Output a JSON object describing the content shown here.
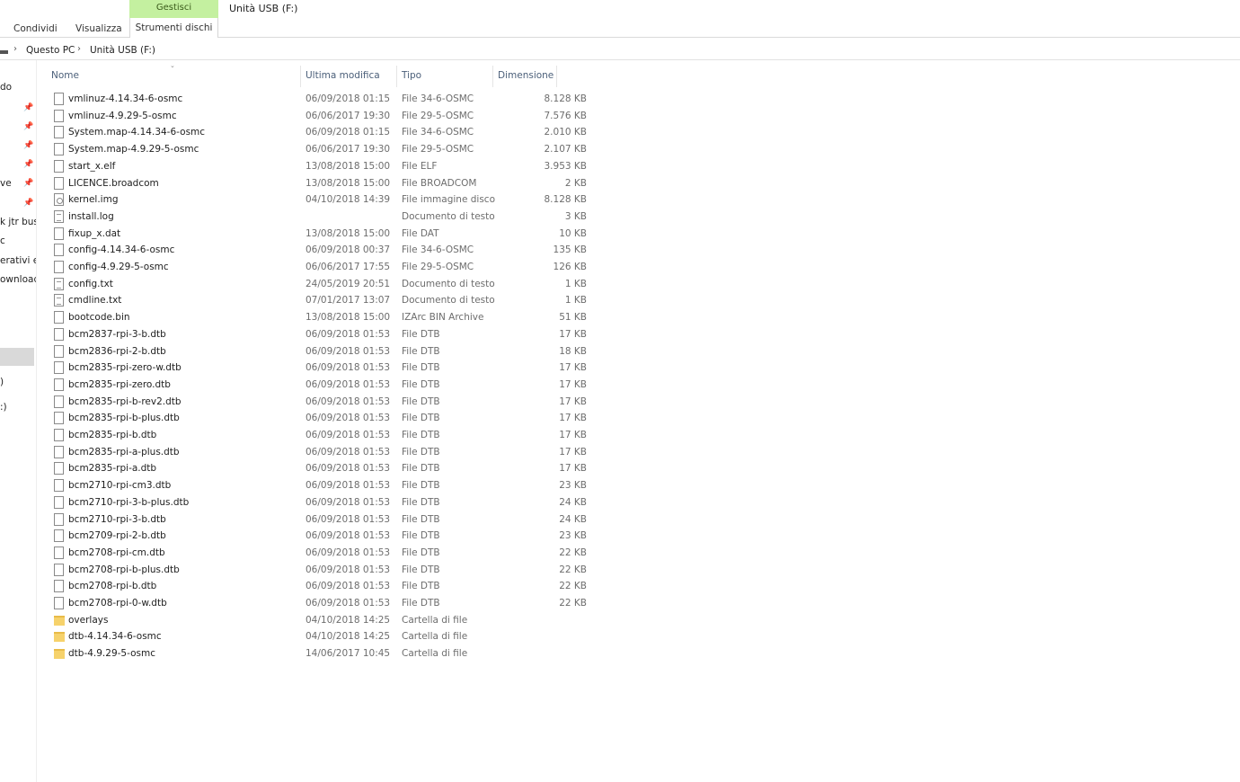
{
  "ribbon": {
    "tabs": [
      "Condividi",
      "Visualizza"
    ],
    "context_group": "Gestisci",
    "context_tab": "Strumenti dischi",
    "window_title": "Unità USB (F:)"
  },
  "address": {
    "crumbs": [
      "Questo PC",
      "Unità USB (F:)"
    ]
  },
  "nav": {
    "items": [
      "do",
      "ve",
      "k jtr busi",
      "c",
      "erativi e S",
      "ownloads",
      ")",
      ":)"
    ]
  },
  "columns": {
    "name": "Nome",
    "modified": "Ultima modifica",
    "type": "Tipo",
    "size": "Dimensione"
  },
  "files": [
    {
      "name": "vmlinuz-4.14.34-6-osmc",
      "date": "06/09/2018 01:15",
      "type": "File 34-6-OSMC",
      "size": "8.128 KB",
      "icon": "file-icon"
    },
    {
      "name": "vmlinuz-4.9.29-5-osmc",
      "date": "06/06/2017 19:30",
      "type": "File 29-5-OSMC",
      "size": "7.576 KB",
      "icon": "file-icon"
    },
    {
      "name": "System.map-4.14.34-6-osmc",
      "date": "06/09/2018 01:15",
      "type": "File 34-6-OSMC",
      "size": "2.010 KB",
      "icon": "file-icon"
    },
    {
      "name": "System.map-4.9.29-5-osmc",
      "date": "06/06/2017 19:30",
      "type": "File 29-5-OSMC",
      "size": "2.107 KB",
      "icon": "file-icon"
    },
    {
      "name": "start_x.elf",
      "date": "13/08/2018 15:00",
      "type": "File ELF",
      "size": "3.953 KB",
      "icon": "file-icon"
    },
    {
      "name": "LICENCE.broadcom",
      "date": "13/08/2018 15:00",
      "type": "File BROADCOM",
      "size": "2 KB",
      "icon": "file-icon"
    },
    {
      "name": "kernel.img",
      "date": "04/10/2018 14:39",
      "type": "File immagine disco",
      "size": "8.128 KB",
      "icon": "disk-image-icon"
    },
    {
      "name": "install.log",
      "date": "",
      "type": "Documento di testo",
      "size": "3 KB",
      "icon": "text-document-icon"
    },
    {
      "name": "fixup_x.dat",
      "date": "13/08/2018 15:00",
      "type": "File DAT",
      "size": "10 KB",
      "icon": "file-icon"
    },
    {
      "name": "config-4.14.34-6-osmc",
      "date": "06/09/2018 00:37",
      "type": "File 34-6-OSMC",
      "size": "135 KB",
      "icon": "file-icon"
    },
    {
      "name": "config-4.9.29-5-osmc",
      "date": "06/06/2017 17:55",
      "type": "File 29-5-OSMC",
      "size": "126 KB",
      "icon": "file-icon"
    },
    {
      "name": "config.txt",
      "date": "24/05/2019 20:51",
      "type": "Documento di testo",
      "size": "1 KB",
      "icon": "text-document-icon"
    },
    {
      "name": "cmdline.txt",
      "date": "07/01/2017 13:07",
      "type": "Documento di testo",
      "size": "1 KB",
      "icon": "text-document-icon"
    },
    {
      "name": "bootcode.bin",
      "date": "13/08/2018 15:00",
      "type": "IZArc BIN Archive",
      "size": "51 KB",
      "icon": "file-icon"
    },
    {
      "name": "bcm2837-rpi-3-b.dtb",
      "date": "06/09/2018 01:53",
      "type": "File DTB",
      "size": "17 KB",
      "icon": "file-icon"
    },
    {
      "name": "bcm2836-rpi-2-b.dtb",
      "date": "06/09/2018 01:53",
      "type": "File DTB",
      "size": "18 KB",
      "icon": "file-icon"
    },
    {
      "name": "bcm2835-rpi-zero-w.dtb",
      "date": "06/09/2018 01:53",
      "type": "File DTB",
      "size": "17 KB",
      "icon": "file-icon"
    },
    {
      "name": "bcm2835-rpi-zero.dtb",
      "date": "06/09/2018 01:53",
      "type": "File DTB",
      "size": "17 KB",
      "icon": "file-icon"
    },
    {
      "name": "bcm2835-rpi-b-rev2.dtb",
      "date": "06/09/2018 01:53",
      "type": "File DTB",
      "size": "17 KB",
      "icon": "file-icon"
    },
    {
      "name": "bcm2835-rpi-b-plus.dtb",
      "date": "06/09/2018 01:53",
      "type": "File DTB",
      "size": "17 KB",
      "icon": "file-icon"
    },
    {
      "name": "bcm2835-rpi-b.dtb",
      "date": "06/09/2018 01:53",
      "type": "File DTB",
      "size": "17 KB",
      "icon": "file-icon"
    },
    {
      "name": "bcm2835-rpi-a-plus.dtb",
      "date": "06/09/2018 01:53",
      "type": "File DTB",
      "size": "17 KB",
      "icon": "file-icon"
    },
    {
      "name": "bcm2835-rpi-a.dtb",
      "date": "06/09/2018 01:53",
      "type": "File DTB",
      "size": "17 KB",
      "icon": "file-icon"
    },
    {
      "name": "bcm2710-rpi-cm3.dtb",
      "date": "06/09/2018 01:53",
      "type": "File DTB",
      "size": "23 KB",
      "icon": "file-icon"
    },
    {
      "name": "bcm2710-rpi-3-b-plus.dtb",
      "date": "06/09/2018 01:53",
      "type": "File DTB",
      "size": "24 KB",
      "icon": "file-icon"
    },
    {
      "name": "bcm2710-rpi-3-b.dtb",
      "date": "06/09/2018 01:53",
      "type": "File DTB",
      "size": "24 KB",
      "icon": "file-icon"
    },
    {
      "name": "bcm2709-rpi-2-b.dtb",
      "date": "06/09/2018 01:53",
      "type": "File DTB",
      "size": "23 KB",
      "icon": "file-icon"
    },
    {
      "name": "bcm2708-rpi-cm.dtb",
      "date": "06/09/2018 01:53",
      "type": "File DTB",
      "size": "22 KB",
      "icon": "file-icon"
    },
    {
      "name": "bcm2708-rpi-b-plus.dtb",
      "date": "06/09/2018 01:53",
      "type": "File DTB",
      "size": "22 KB",
      "icon": "file-icon"
    },
    {
      "name": "bcm2708-rpi-b.dtb",
      "date": "06/09/2018 01:53",
      "type": "File DTB",
      "size": "22 KB",
      "icon": "file-icon"
    },
    {
      "name": "bcm2708-rpi-0-w.dtb",
      "date": "06/09/2018 01:53",
      "type": "File DTB",
      "size": "22 KB",
      "icon": "file-icon"
    },
    {
      "name": "overlays",
      "date": "04/10/2018 14:25",
      "type": "Cartella di file",
      "size": "",
      "icon": "folder-icon"
    },
    {
      "name": "dtb-4.14.34-6-osmc",
      "date": "04/10/2018 14:25",
      "type": "Cartella di file",
      "size": "",
      "icon": "folder-icon"
    },
    {
      "name": "dtb-4.9.29-5-osmc",
      "date": "14/06/2017 10:45",
      "type": "Cartella di file",
      "size": "",
      "icon": "folder-icon"
    }
  ]
}
